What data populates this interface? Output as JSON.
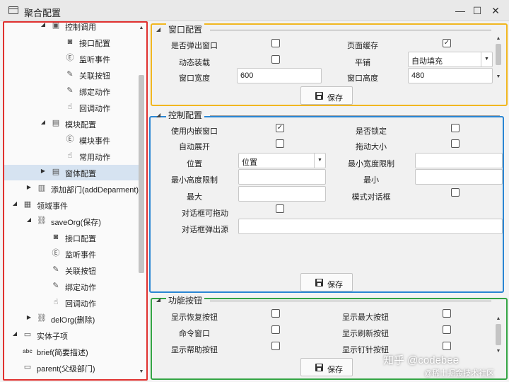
{
  "window": {
    "title": "聚合配置",
    "minimize": "—",
    "maximize": "☐",
    "close": "✕"
  },
  "tree": [
    {
      "label": "控制调用",
      "icon": "bubble-icon",
      "glyph": "▣",
      "arrow": "◢"
    },
    {
      "label": "接口配置",
      "icon": "bubble-icon",
      "glyph": "◙",
      "arrow": ""
    },
    {
      "label": "监听事件",
      "icon": "event-icon",
      "glyph": "Ⓔ",
      "arrow": ""
    },
    {
      "label": "关联按钮",
      "icon": "edit-document-icon",
      "glyph": "✎",
      "arrow": ""
    },
    {
      "label": "绑定动作",
      "icon": "edit-document-icon",
      "glyph": "✎",
      "arrow": ""
    },
    {
      "label": "回调动作",
      "icon": "pointer-hand-icon",
      "glyph": "☝",
      "arrow": ""
    },
    {
      "label": "模块配置",
      "icon": "document-icon",
      "glyph": "▤",
      "arrow": "◢"
    },
    {
      "label": "模块事件",
      "icon": "event-icon",
      "glyph": "Ⓔ",
      "arrow": ""
    },
    {
      "label": "常用动作",
      "icon": "pointer-hand-icon",
      "glyph": "☝",
      "arrow": ""
    },
    {
      "label": "窗体配置",
      "icon": "document-icon",
      "glyph": "▤",
      "arrow": "▶"
    },
    {
      "label": "添加部门(addDeparment)",
      "icon": "form-icon",
      "glyph": "▥",
      "arrow": "▶"
    },
    {
      "label": "领域事件",
      "icon": "grid-icon",
      "glyph": "▦",
      "arrow": "◢"
    },
    {
      "label": "saveOrg(保存)",
      "icon": "chain-icon",
      "glyph": "⛓",
      "arrow": "◢"
    },
    {
      "label": "接口配置",
      "icon": "bubble-icon",
      "glyph": "◙",
      "arrow": ""
    },
    {
      "label": "监听事件",
      "icon": "event-icon",
      "glyph": "Ⓔ",
      "arrow": ""
    },
    {
      "label": "关联按钮",
      "icon": "edit-document-icon",
      "glyph": "✎",
      "arrow": ""
    },
    {
      "label": "绑定动作",
      "icon": "edit-document-icon",
      "glyph": "✎",
      "arrow": ""
    },
    {
      "label": "回调动作",
      "icon": "pointer-hand-icon",
      "glyph": "☝",
      "arrow": ""
    },
    {
      "label": "delOrg(删除)",
      "icon": "chain-icon",
      "glyph": "⛓",
      "arrow": "▶"
    },
    {
      "label": "实体子项",
      "icon": "tab-icon",
      "glyph": "▭",
      "arrow": "◢"
    },
    {
      "label": "brief(简要描述)",
      "icon": "abc-icon",
      "glyph": "abc",
      "arrow": ""
    },
    {
      "label": "parent(父级部门)",
      "icon": "tab-icon",
      "glyph": "▭",
      "arrow": ""
    }
  ],
  "selected_tree_item": "窗体配置",
  "window_config": {
    "title": "窗口配置",
    "popup_window_label": "是否弹出窗口",
    "popup_window_checked": false,
    "page_cache_label": "页面缓存",
    "page_cache_checked": true,
    "dynamic_load_label": "动态装载",
    "dynamic_load_checked": false,
    "tile_label": "平铺",
    "tile_value": "自动填充",
    "width_label": "窗口宽度",
    "width_value": "600",
    "height_label": "窗口高度",
    "height_value": "480",
    "save_label": "保存"
  },
  "control_config": {
    "title": "控制配置",
    "use_inner_window_label": "使用内嵌窗口",
    "use_inner_window_checked": true,
    "locked_label": "是否锁定",
    "locked_checked": false,
    "auto_expand_label": "自动展开",
    "auto_expand_checked": false,
    "drag_resize_label": "拖动大小",
    "drag_resize_checked": false,
    "position_label": "位置",
    "position_value": "位置",
    "min_width_label": "最小宽度限制",
    "min_width_value": "",
    "min_height_label": "最小高度限制",
    "min_height_value": "",
    "min_label": "最小",
    "min_value": "",
    "max_label": "最大",
    "max_value": "",
    "modal_label": "模式对话框",
    "modal_checked": false,
    "draggable_label": "对话框可拖动",
    "draggable_checked": false,
    "popup_source_label": "对话框弹出源",
    "popup_source_value": "",
    "save_label": "保存"
  },
  "function_buttons": {
    "title": "功能按钮",
    "restore_label": "显示恢复按钮",
    "restore_checked": false,
    "maximize_label": "显示最大按钮",
    "maximize_checked": false,
    "command_window_label": "命令窗口",
    "command_window_checked": false,
    "refresh_label": "显示刷新按钮",
    "refresh_checked": false,
    "help_label": "显示帮助按钮",
    "help_checked": false,
    "pin_label": "显示钉针按钮",
    "pin_checked": false,
    "save_label": "保存"
  },
  "watermark": {
    "line1": "知乎 @codebee",
    "line2": "@稀土掘金技术社区"
  },
  "colors": {
    "tree_border": "#e0312f",
    "window_border": "#f1b720",
    "control_border": "#2a86d3",
    "buttons_border": "#34a545",
    "selection": "#d6e3f1"
  }
}
